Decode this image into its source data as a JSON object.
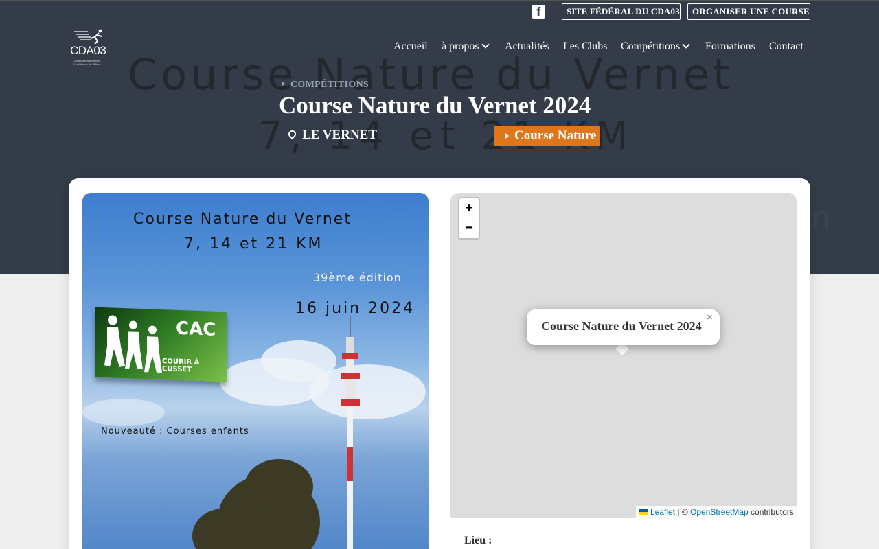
{
  "hero": {
    "ghost_line1": "Course Nature du Vernet",
    "ghost_line2": "7, 14 et 21 KM",
    "ghost_line3": "n"
  },
  "topbar": {
    "facebook_icon": "facebook-square-icon",
    "site_federal": "SITE FÉDÉRAL DU CDA03",
    "organiser": "ORGANISER UNE COURSE"
  },
  "logo": {
    "name": "CDA03",
    "tagline": "Comité départemental d'Athlétisme de l'Allier"
  },
  "nav": {
    "accueil": "Accueil",
    "apropos": "à propos",
    "actualites": "Actualités",
    "clubs": "Les Clubs",
    "competitions": "Compétitions",
    "formations": "Formations",
    "contact": "Contact"
  },
  "event": {
    "breadcrumb": "COMPÉTITIONS",
    "title": "Course Nature du Vernet 2024",
    "location": "LE VERNET",
    "category": "Course Nature"
  },
  "poster": {
    "title": "Course Nature du Vernet",
    "distances": "7, 14 et 21 KM",
    "edition": "39ème édition",
    "date": "16 juin 2024",
    "club_short": "CAC",
    "club_full": "COURIR À CUSSET",
    "news": "Nouveauté : Courses enfants"
  },
  "map": {
    "zoom_in": "+",
    "zoom_out": "−",
    "popup_title": "Course Nature du Vernet 2024",
    "popup_close": "×",
    "attrib_leaflet": "Leaflet",
    "attrib_sep": " | © ",
    "attrib_osm": "OpenStreetMap",
    "attrib_contrib": " contributors"
  },
  "details": {
    "lieu_label": "Lieu :"
  },
  "colors": {
    "header_bg": "#333c48",
    "accent_orange": "#de761b",
    "page_bg": "#efefef"
  }
}
